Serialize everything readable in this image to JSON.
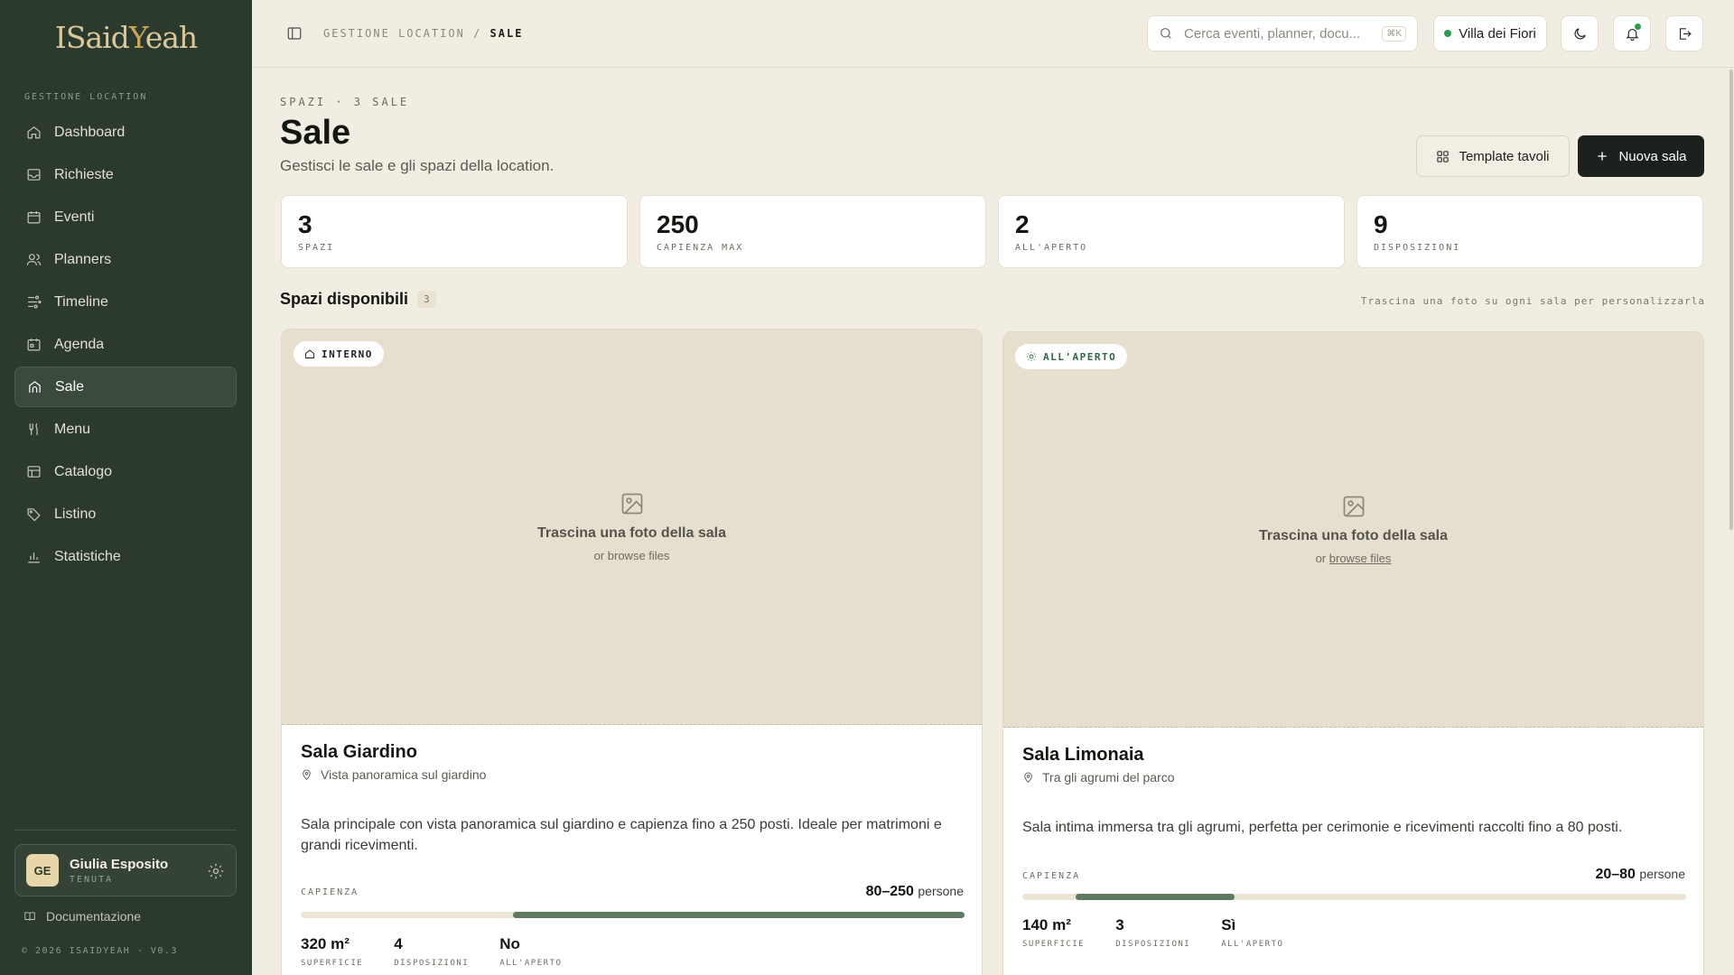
{
  "app": {
    "logo_text": "ISaidYeah",
    "copyright": "© 2026 ISAIDYEAH · V0.3"
  },
  "sidebar": {
    "section_label": "GESTIONE LOCATION",
    "items": [
      {
        "label": "Dashboard",
        "icon": "home-icon"
      },
      {
        "label": "Richieste",
        "icon": "inbox-icon"
      },
      {
        "label": "Eventi",
        "icon": "calendar-icon"
      },
      {
        "label": "Planners",
        "icon": "users-icon"
      },
      {
        "label": "Timeline",
        "icon": "timeline-icon"
      },
      {
        "label": "Agenda",
        "icon": "agenda-icon"
      },
      {
        "label": "Sale",
        "icon": "venue-icon",
        "active": true
      },
      {
        "label": "Menu",
        "icon": "utensils-icon"
      },
      {
        "label": "Catalogo",
        "icon": "catalog-icon"
      },
      {
        "label": "Listino",
        "icon": "tag-icon"
      },
      {
        "label": "Statistiche",
        "icon": "bar-chart-icon"
      }
    ],
    "user": {
      "initials": "GE",
      "name": "Giulia Esposito",
      "role": "TENUTA"
    },
    "docs_label": "Documentazione"
  },
  "topbar": {
    "breadcrumb_root": "GESTIONE LOCATION",
    "breadcrumb_sep": "/",
    "breadcrumb_current": "SALE",
    "search_placeholder": "Cerca eventi, planner, docu...",
    "search_shortcut": "⌘K",
    "venue_name": "Villa dei Fiori"
  },
  "page": {
    "eyebrow": "SPAZI · 3 SALE",
    "title": "Sale",
    "subtitle": "Gestisci le sale e gli spazi della location.",
    "template_button": "Template tavoli",
    "new_button": "Nuova sala"
  },
  "stats": [
    {
      "value": "3",
      "label": "SPAZI"
    },
    {
      "value": "250",
      "label": "CAPIENZA MAX"
    },
    {
      "value": "2",
      "label": "ALL'APERTO"
    },
    {
      "value": "9",
      "label": "DISPOSIZIONI"
    }
  ],
  "spaces_section": {
    "title": "Spazi disponibili",
    "count": "3",
    "hint": "Trascina una foto su ogni sala per personalizzarla"
  },
  "rooms": [
    {
      "tag": "INTERNO",
      "photo_title": "Trascina una foto della sala",
      "photo_or": "or",
      "photo_link": "browse files",
      "name": "Sala Giardino",
      "location": "Vista panoramica sul giardino",
      "description": "Sala principale con vista panoramica sul giardino e capienza fino a 250 posti. Ideale per matrimoni e grandi ricevimenti.",
      "capacity_label": "CAPIENZA",
      "capacity_value": "80–250",
      "capacity_unit": "persone",
      "capacity_min": 80,
      "capacity_max": 250,
      "area": "320 m²",
      "area_label": "SUPERFICIE",
      "layouts": "4",
      "layouts_label": "DISPOSIZIONI",
      "outdoor": "No",
      "outdoor_label": "ALL'APERTO"
    },
    {
      "tag": "ALL'APERTO",
      "photo_title": "Trascina una foto della sala",
      "photo_or": "or",
      "photo_link": "browse files",
      "name": "Sala Limonaia",
      "location": "Tra gli agrumi del parco",
      "description": "Sala intima immersa tra gli agrumi, perfetta per cerimonie e ricevimenti raccolti fino a 80 posti.",
      "capacity_label": "CAPIENZA",
      "capacity_value": "20–80",
      "capacity_unit": "persone",
      "capacity_min": 20,
      "capacity_max": 80,
      "area": "140 m²",
      "area_label": "SUPERFICIE",
      "layouts": "3",
      "layouts_label": "DISPOSIZIONI",
      "outdoor": "Sì",
      "outdoor_label": "ALL'APERTO"
    }
  ],
  "colors": {
    "sidebar_bg": "#2c3a2e",
    "page_bg": "#f2ede2",
    "accent": "#5f7a60",
    "primary_button": "#1c211d",
    "status_dot": "#2e9a4f"
  }
}
